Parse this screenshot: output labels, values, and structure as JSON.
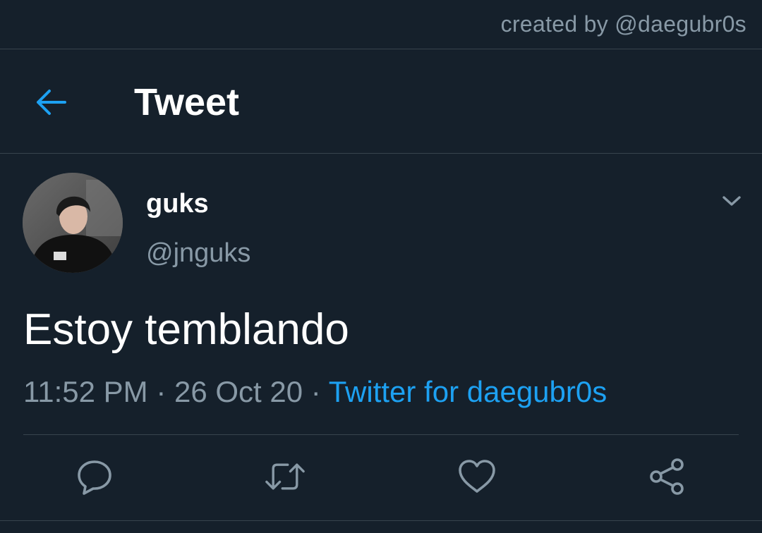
{
  "credit": "created by @daegubr0s",
  "header": {
    "title": "Tweet"
  },
  "tweet": {
    "display_name": "guks",
    "handle": "@jnguks",
    "text": "Estoy temblando",
    "time": "11:52 PM",
    "date": "26 Oct 20",
    "source": "Twitter for daegubr0s",
    "separator": "·"
  },
  "icons": {
    "back": "arrow-left-icon",
    "menu": "chevron-down-icon",
    "reply": "reply-icon",
    "retweet": "retweet-icon",
    "like": "heart-icon",
    "share": "share-icon"
  },
  "colors": {
    "background": "#15202b",
    "accent": "#1da1f2",
    "muted": "#8899a6",
    "divider": "#38444d",
    "text": "#ffffff"
  }
}
